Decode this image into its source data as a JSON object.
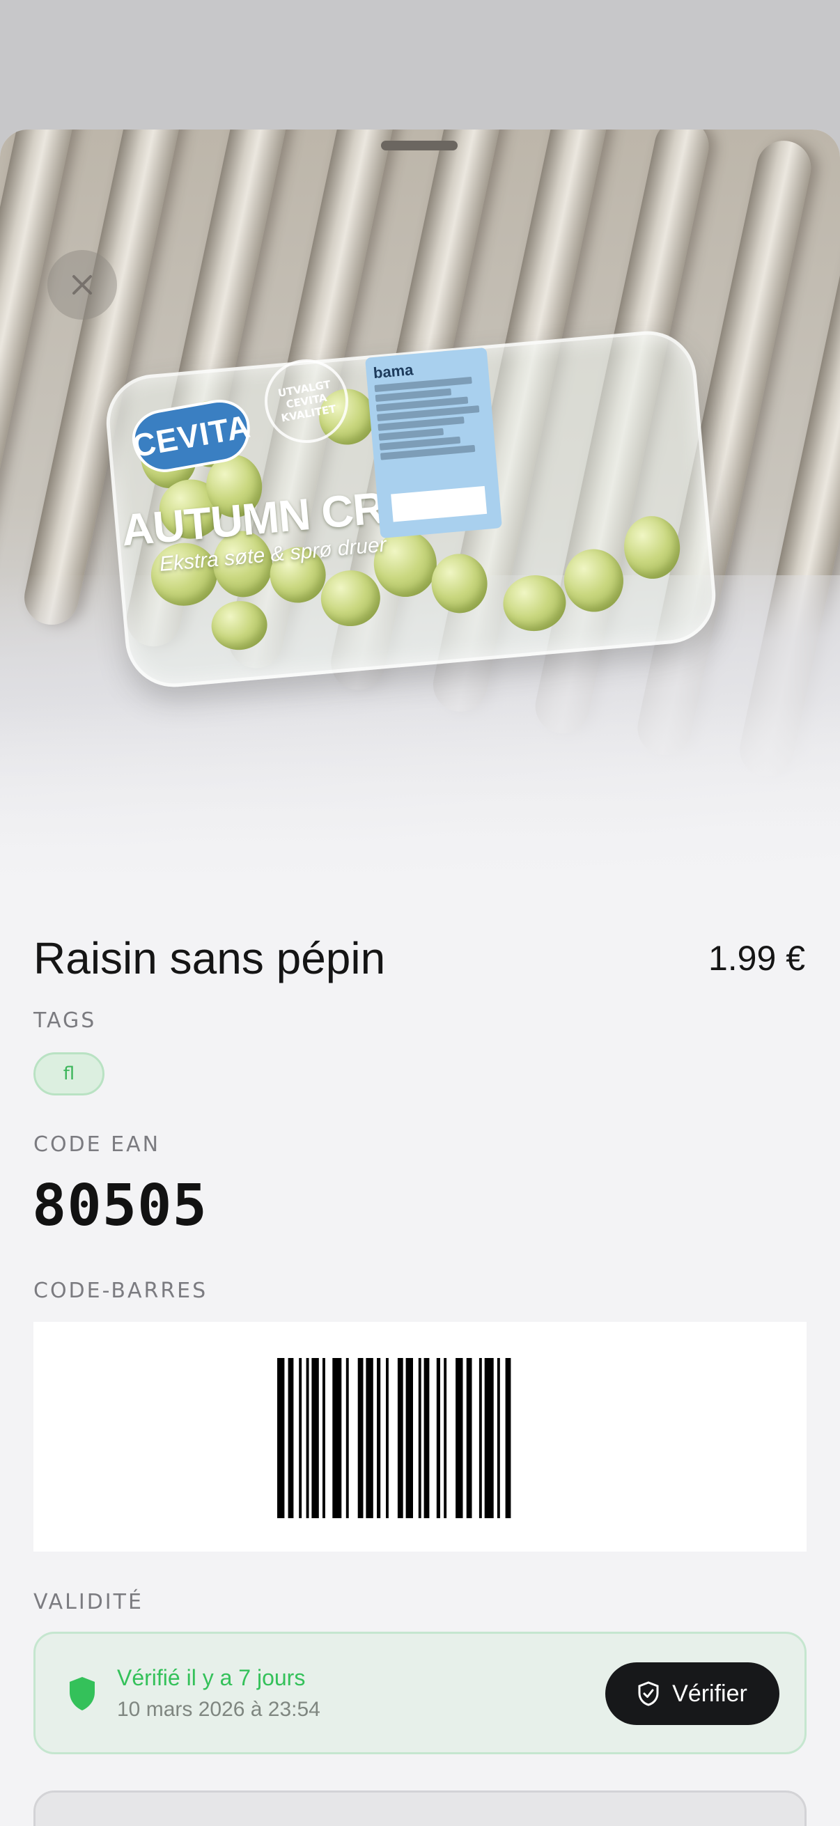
{
  "sheet": {
    "close_icon": "close-icon",
    "photo": {
      "pack_brand": "CEVITA",
      "pack_seal": "UTVALGT CEVITA KVALITET",
      "pack_product": "AUTUMN CRISP",
      "pack_tagline": "Ekstra søte & sprø druer",
      "pack_label_brand": "bama"
    }
  },
  "product": {
    "name": "Raisin sans pépin",
    "price": "1.99 €"
  },
  "tags": {
    "label": "TAGS",
    "items": [
      "fl"
    ]
  },
  "ean": {
    "label": "CODE EAN",
    "value": "80505"
  },
  "barcode": {
    "label": "CODE-BARRES"
  },
  "validity": {
    "label": "VALIDITÉ",
    "status": "Vérifié il y a 7 jours",
    "date": "10 mars 2026 à 23:54",
    "button_label": "Vérifier",
    "shield_icon": "shield-icon",
    "button_icon": "shield-check-icon",
    "accent_color": "#34c15a"
  }
}
